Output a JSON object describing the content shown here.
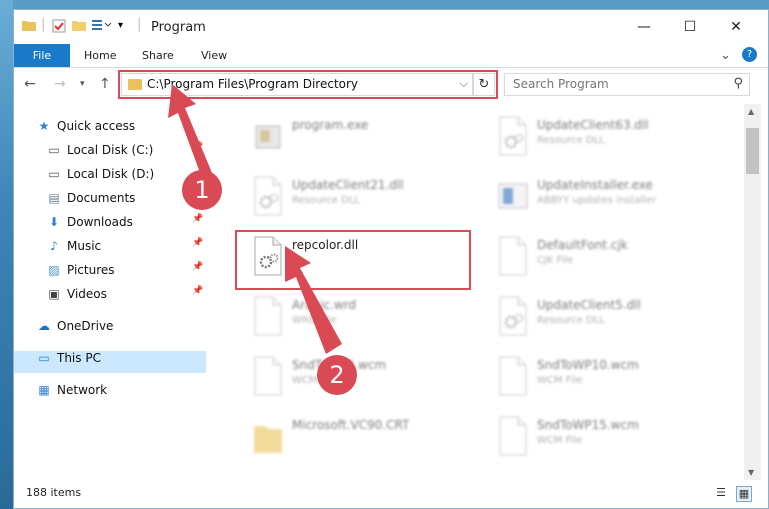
{
  "window": {
    "title": "Program",
    "quick_access_icons": [
      "folder-icon",
      "properties-icon",
      "new-folder-icon",
      "customize-icon"
    ],
    "controls": {
      "minimize": "—",
      "maximize": "☐",
      "close": "✕"
    }
  },
  "ribbon": {
    "tabs": [
      "File",
      "Home",
      "Share",
      "View"
    ],
    "expand": "⌄",
    "help": "?"
  },
  "address_bar": {
    "path": "C:\\Program Files\\Program Directory",
    "search_placeholder": "Search Program"
  },
  "nav_pane": {
    "items": [
      {
        "label": "Quick access",
        "icon": "quick-access-star-icon",
        "pinned": false
      },
      {
        "label": "Local Disk (C:)",
        "icon": "drive-icon",
        "pinned": true
      },
      {
        "label": "Local Disk (D:)",
        "icon": "drive-icon",
        "pinned": false
      },
      {
        "label": "Documents",
        "icon": "documents-icon",
        "pinned": true
      },
      {
        "label": "Downloads",
        "icon": "downloads-icon",
        "pinned": true
      },
      {
        "label": "Music",
        "icon": "music-icon",
        "pinned": true
      },
      {
        "label": "Pictures",
        "icon": "pictures-icon",
        "pinned": true
      },
      {
        "label": "Videos",
        "icon": "videos-icon",
        "pinned": true
      },
      {
        "label": "OneDrive",
        "icon": "onedrive-cloud-icon",
        "pinned": false
      },
      {
        "label": "This PC",
        "icon": "this-pc-icon",
        "pinned": false,
        "selected": true
      },
      {
        "label": "Network",
        "icon": "network-icon",
        "pinned": false
      }
    ]
  },
  "files": [
    {
      "name": "program.exe",
      "type": "",
      "icon": "exe-icon",
      "col": 0,
      "row": 0,
      "blurred": true
    },
    {
      "name": "UpdateClient63.dll",
      "type": "Resource DLL",
      "icon": "dll-icon",
      "col": 1,
      "row": 0,
      "blurred": true
    },
    {
      "name": "UpdateClient21.dll",
      "type": "Resource DLL",
      "icon": "dll-icon",
      "col": 0,
      "row": 1,
      "blurred": true
    },
    {
      "name": "UpdateInstaller.exe",
      "type": "ABBYY updates installer",
      "icon": "installer-icon",
      "col": 1,
      "row": 1,
      "blurred": true
    },
    {
      "name": "repcolor.dll",
      "type": "",
      "icon": "dll-gear-icon",
      "col": 0,
      "row": 2,
      "blurred": false
    },
    {
      "name": "DefaultFont.cjk",
      "type": "CJK File",
      "icon": "file-icon",
      "col": 1,
      "row": 2,
      "blurred": true
    },
    {
      "name": "Arabic.wrd",
      "type": "WRD File",
      "icon": "file-icon",
      "col": 0,
      "row": 3,
      "blurred": true
    },
    {
      "name": "UpdateClient5.dll",
      "type": "Resource DLL",
      "icon": "dll-icon",
      "col": 1,
      "row": 3,
      "blurred": true
    },
    {
      "name": "SndToWP8.wcm",
      "type": "WCM File",
      "icon": "file-icon",
      "col": 0,
      "row": 4,
      "blurred": true
    },
    {
      "name": "SndToWP10.wcm",
      "type": "WCM File",
      "icon": "file-icon",
      "col": 1,
      "row": 4,
      "blurred": true
    },
    {
      "name": "Microsoft.VC90.CRT",
      "type": "",
      "icon": "folder-icon",
      "col": 0,
      "row": 5,
      "blurred": true
    },
    {
      "name": "SndToWP15.wcm",
      "type": "WCM File",
      "icon": "file-icon",
      "col": 1,
      "row": 5,
      "blurred": true
    }
  ],
  "status_bar": {
    "count": "188 items"
  },
  "annotations": {
    "step1": "1",
    "step2": "2",
    "color": "#d94a54"
  }
}
